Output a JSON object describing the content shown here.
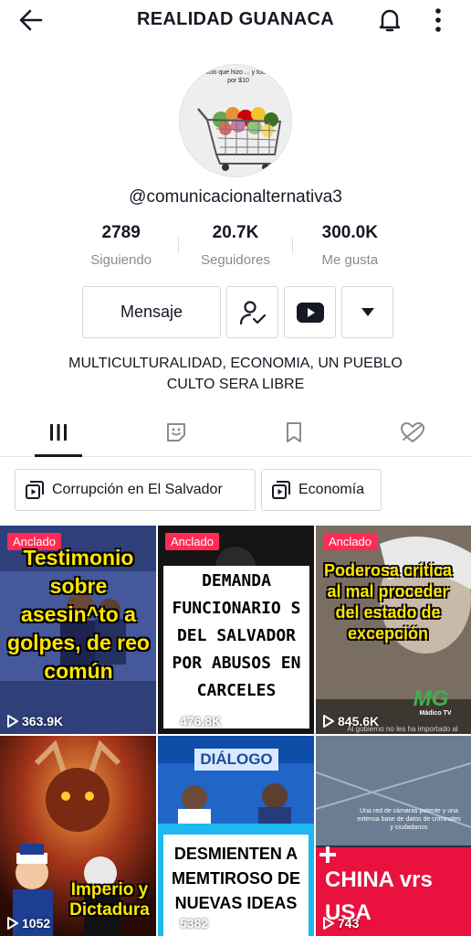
{
  "header": {
    "title": "REALIDAD GUANACA"
  },
  "profile": {
    "avatar_text": "Anuncio que hizo ... y todo esto por $10",
    "username": "@comunicacionalternativa3",
    "stats": [
      {
        "value": "2789",
        "label": "Siguiendo"
      },
      {
        "value": "20.7K",
        "label": "Seguidores"
      },
      {
        "value": "300.0K",
        "label": "Me gusta"
      }
    ],
    "message_label": "Mensaje",
    "bio_line1": "MULTICULTURALIDAD, ECONOMIA, UN PUEBLO",
    "bio_line2": "CULTO SERA LIBRE"
  },
  "playlists": [
    {
      "label": "Corrupción en El Salvador"
    },
    {
      "label": "Economía"
    }
  ],
  "videos": [
    {
      "pinned": "Anclado",
      "caption": "Testimonio sobre asesin^to a golpes, de reo común",
      "views": "363.9K"
    },
    {
      "pinned": "Anclado",
      "caption": "DEMANDA FUNCIONARIO S DEL SALVADOR POR ABUSOS EN CARCELES",
      "views": "476.8K"
    },
    {
      "pinned": "Anclado",
      "caption": "Poderosa crítica al mal proceder del estado de excepción",
      "watermark": "MG",
      "watermark_sub": "Mádico TV",
      "footer": "Al gobierno no les ha importado al",
      "views": "845.6K"
    },
    {
      "caption": "Imperio y Dictadura",
      "views": "1052"
    },
    {
      "brand": "DIÁLOGO",
      "caption": "DESMIENTEN A MEMTIROSO DE NUEVAS IDEAS",
      "views": "5382"
    },
    {
      "subcaption": "Una red de cámaras potente y una extensa base de datos de criminales y ciudadanos",
      "caption": "CHINA vrs USA",
      "views": "743"
    }
  ],
  "colors": {
    "pinned_badge": "#fe2c55",
    "text_primary": "#161823",
    "text_secondary": "#8a8b91"
  }
}
